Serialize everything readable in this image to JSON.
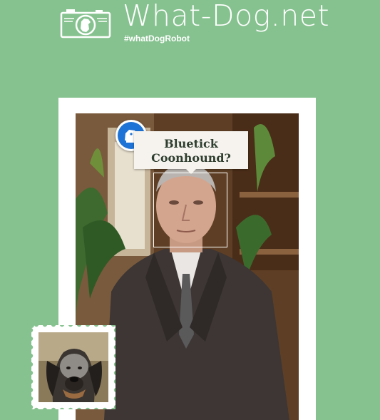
{
  "header": {
    "title": "What-Dog.net",
    "hashtag": "#whatDogRobot",
    "logo_icon": "camera-dog-icon"
  },
  "result": {
    "breed_line1": "Bluetick",
    "breed_line2": "Coonhound?",
    "badge_icon": "robot-dog-icon",
    "stamp_image": "bluetick-coonhound-photo"
  },
  "colors": {
    "background": "#86c28f",
    "badge": "#1e73d6",
    "bubble": "#f6f3ee",
    "bubble_text": "#2f3e2f"
  }
}
